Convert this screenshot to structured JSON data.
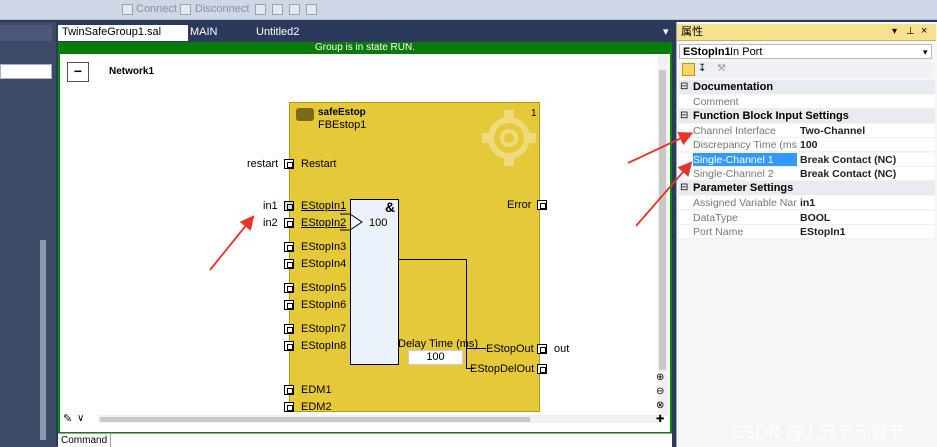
{
  "toolbar": {
    "connect": "Connect",
    "disconnect": "Disconnect"
  },
  "tabs": [
    "TwinSafeGroup1.sal",
    "MAIN",
    "Untitled2"
  ],
  "tab_close": "×",
  "editor": {
    "status": "Group is in state RUN.",
    "network_title": "Network1",
    "collapse_symbol": "−",
    "command_label": "Command :"
  },
  "fb": {
    "name": "safeEstop",
    "instance": "FBEstop1",
    "number": "1",
    "inputs": [
      "Restart",
      "EStopIn1",
      "EStopIn2",
      "EStopIn3",
      "EStopIn4",
      "EStopIn5",
      "EStopIn6",
      "EStopIn7",
      "EStopIn8",
      "EDM1",
      "EDM2"
    ],
    "outputs": [
      "Error",
      "EStopOut",
      "EStopDelOut"
    ],
    "and_symbol": "&",
    "and_value": "100",
    "delay_label": "Delay Time (ms)",
    "delay_value": "100"
  },
  "external": {
    "restart": "restart",
    "in1": "in1",
    "in2": "in2",
    "out": "out"
  },
  "props": {
    "title": "属性",
    "object_name": "EStopIn1",
    "object_type": "In Port",
    "categories": {
      "documentation": "Documentation",
      "fb_input": "Function Block Input Settings",
      "param": "Parameter Settings"
    },
    "comment": "Comment",
    "rows_fb": [
      {
        "name": "Channel Interface",
        "value": "Two-Channel"
      },
      {
        "name": "Discrepancy Time (ms)",
        "value": "100"
      },
      {
        "name": "Single-Channel 1",
        "value": "Break Contact (NC)"
      },
      {
        "name": "Single-Channel 2",
        "value": "Break Contact (NC)"
      }
    ],
    "rows_param": [
      {
        "name": "Assigned Variable Nam",
        "value": "in1"
      },
      {
        "name": "DataType",
        "value": "BOOL"
      },
      {
        "name": "Port Name",
        "value": "EStopIn1"
      }
    ]
  },
  "watermark": "CSDN @上元节元宵节",
  "colors": {
    "group_run": "#0a7a0a",
    "fb_fill": "#e6c938",
    "arrow": "#e8332a"
  }
}
